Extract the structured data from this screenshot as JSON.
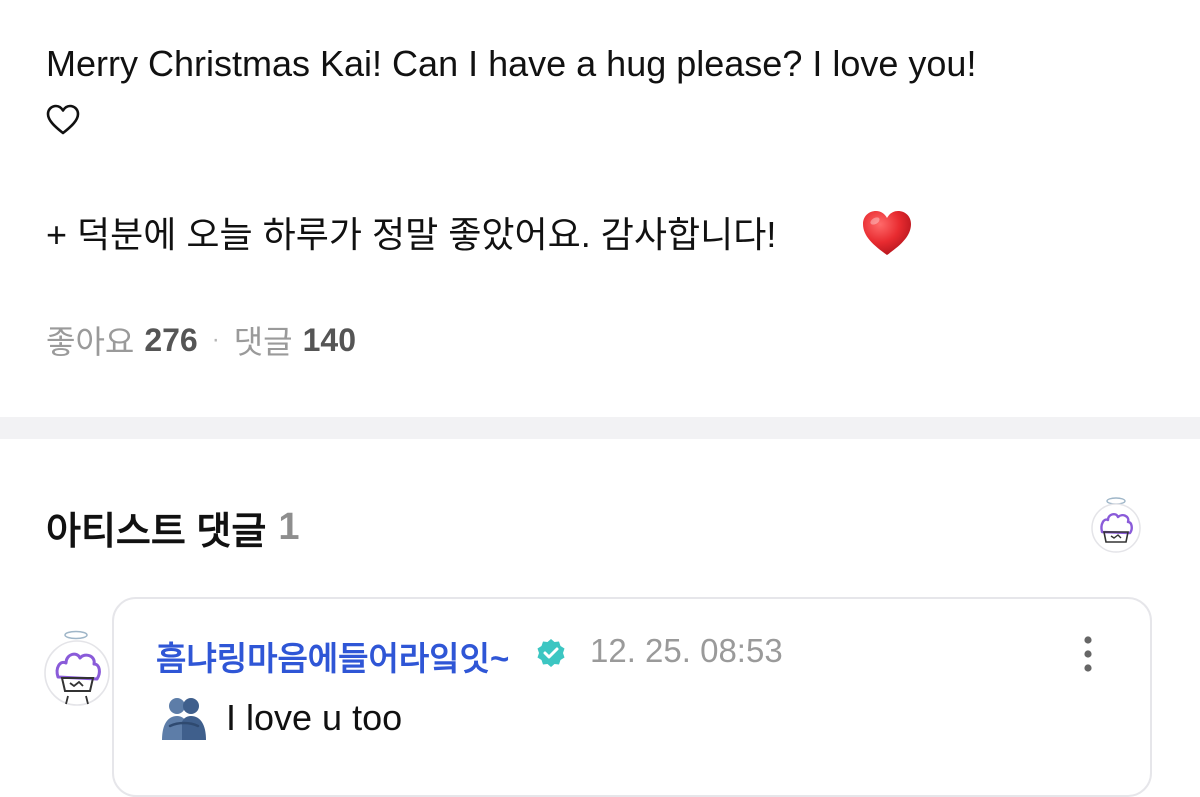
{
  "post": {
    "line1": "Merry Christmas Kai! Can I have a hug please? I love you!",
    "line1_end_icon": "heart-outline-icon",
    "line3": "+ 덕분에 오늘 하루가 정말 좋았어요. 감사합니다!",
    "line3_end_icon": "red-heart-emoji"
  },
  "stats": {
    "likes_label": "좋아요",
    "likes_count": "276",
    "separator": "·",
    "comments_label": "댓글",
    "comments_count": "140"
  },
  "artist_comments": {
    "title": "아티스트 댓글",
    "count": "1",
    "avatar_icon": "artist-avatar-icon"
  },
  "comment": {
    "nickname": "흠냐링마음에들어라잌잇~",
    "verified_icon": "verified-badge-icon",
    "timestamp": "12. 25. 08:53",
    "more_icon": "more-vertical-icon",
    "emoji_icon": "hug-emoji",
    "text": "I love u too"
  },
  "colors": {
    "nickname": "#2f56d6",
    "verified": "#3cc6c2",
    "muted_text": "#9a9a9a",
    "divider": "#f2f2f4",
    "heart": "#e0202a"
  }
}
